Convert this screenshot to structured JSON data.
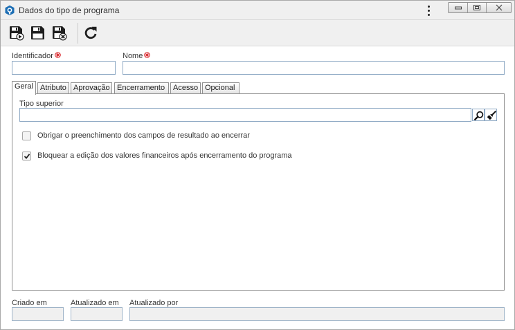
{
  "window": {
    "title": "Dados do tipo de programa",
    "icon": "app-logo-icon",
    "controls": [
      "kebab-menu-icon",
      "minimize-icon",
      "maximize-icon",
      "close-icon"
    ]
  },
  "toolbar": {
    "buttons": [
      {
        "name": "save-and-new-button",
        "icon": "floppy-disk-arrow-icon"
      },
      {
        "name": "save-button",
        "icon": "floppy-disk-icon"
      },
      {
        "name": "save-and-close-button",
        "icon": "floppy-disk-x-icon"
      },
      {
        "name": "refresh-button",
        "icon": "refresh-icon"
      }
    ]
  },
  "form": {
    "identificador": {
      "label": "Identificador",
      "value": "",
      "required": true
    },
    "nome": {
      "label": "Nome",
      "value": "",
      "required": true
    }
  },
  "tabs": [
    {
      "label": "Geral",
      "active": true
    },
    {
      "label": "Atributo",
      "active": false
    },
    {
      "label": "Aprovação",
      "active": false
    },
    {
      "label": "Encerramento",
      "active": false
    },
    {
      "label": "Acesso",
      "active": false
    },
    {
      "label": "Opcional",
      "active": false
    }
  ],
  "geral": {
    "tipo_superior": {
      "label": "Tipo superior",
      "value": ""
    },
    "checkboxes": [
      {
        "label": "Obrigar o preenchimento dos campos de resultado ao encerrar",
        "checked": false
      },
      {
        "label": "Bloquear a edição dos valores financeiros após encerramento do programa",
        "checked": true
      }
    ]
  },
  "footer": {
    "criado_em": {
      "label": "Criado em",
      "value": ""
    },
    "atualizado_em": {
      "label": "Atualizado em",
      "value": ""
    },
    "atualizado_por": {
      "label": "Atualizado por",
      "value": ""
    }
  },
  "colors": {
    "required": "#d9262c",
    "input_border": "#8ea9c4",
    "chrome": "#f0f0f0"
  }
}
